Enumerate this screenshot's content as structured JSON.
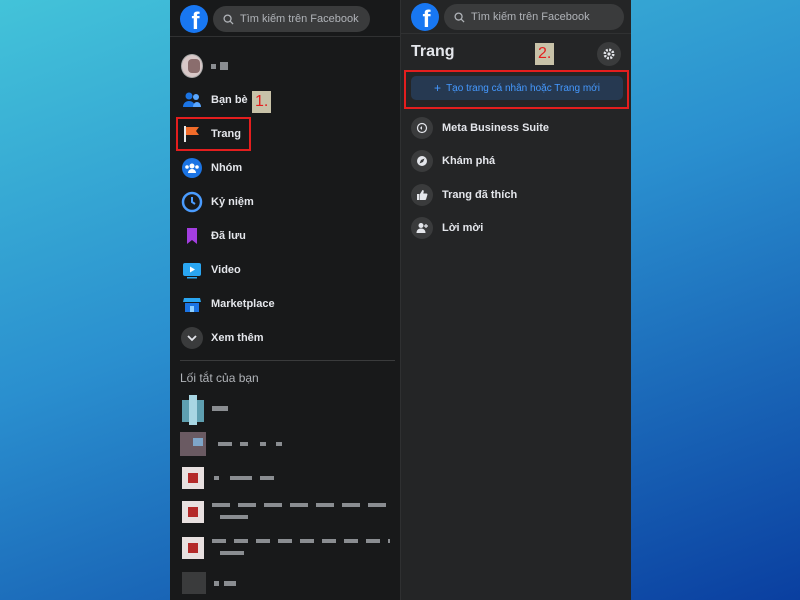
{
  "left_panel": {
    "search_placeholder": "Tìm kiếm trên Facebook",
    "nav": {
      "friends": "Bạn bè",
      "pages": "Trang",
      "groups": "Nhóm",
      "memories": "Kỷ niệm",
      "saved": "Đã lưu",
      "video": "Video",
      "marketplace": "Marketplace",
      "see_more": "Xem thêm"
    },
    "shortcuts_title": "Lối tắt của bạn"
  },
  "right_panel": {
    "search_placeholder": "Tìm kiếm trên Facebook",
    "title": "Trang",
    "create_button": "Tạo trang cá nhân hoặc Trang mới",
    "items": {
      "meta_business": "Meta Business Suite",
      "discover": "Khám phá",
      "liked_pages": "Trang đã thích",
      "invites": "Lời mời"
    }
  },
  "annotations": {
    "step1": "1.",
    "step2": "2."
  },
  "colors": {
    "panel_bg": "#18191a",
    "panel_bg_right": "#242526",
    "accent_blue": "#1877f2",
    "highlight_red": "#e41e1e",
    "text_primary": "#e4e6eb",
    "text_secondary": "#b0b3b8"
  },
  "icons": {
    "logo": "facebook-logo",
    "search": "search-icon",
    "friends": "friends-icon",
    "pages": "flag-icon",
    "groups": "groups-icon",
    "memories": "clock-icon",
    "saved": "bookmark-icon",
    "video": "video-icon",
    "marketplace": "shop-icon",
    "see_more": "chevron-down-icon",
    "settings": "gear-icon",
    "meta_business": "meta-business-icon",
    "discover": "compass-icon",
    "liked": "thumbs-up-icon",
    "invites": "add-person-icon"
  }
}
